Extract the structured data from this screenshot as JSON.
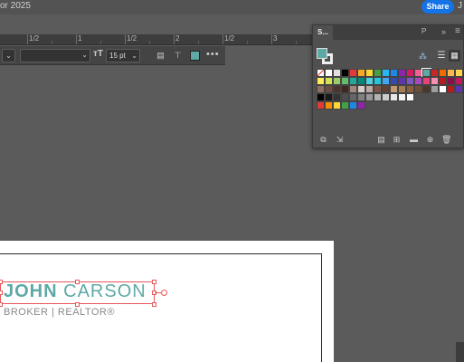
{
  "window": {
    "title_fragment": "or 2025",
    "share_label": "Share",
    "after_share": "J"
  },
  "ruler": {
    "labels": [
      "1/2",
      "1",
      "1/2",
      "2",
      "1/2",
      "3"
    ]
  },
  "control_bar": {
    "font_style_value": "",
    "font_size_value": "15 pt",
    "size_icon": "text-size-icon",
    "more_label": "•••"
  },
  "swatches_panel": {
    "tab_label": "S...",
    "other_tab_label": "P",
    "collapse_label": "»",
    "menu_label": "≡",
    "fill_color": "#5ea9a5",
    "view_list_icon": "list-view-icon",
    "view_grid_icon": "grid-view-icon",
    "swatch_rows": [
      [
        "none",
        "#ffffff",
        "#e0e0e0",
        "#000000",
        "#e53935",
        "#f9a825",
        "#fdd835",
        "#43a047",
        "#29b6f6",
        "#1e88e5",
        "#8e24aa",
        "#d81b60",
        "#f06292",
        "#5ea9a5",
        "#c62828",
        "#ef6c00",
        "#ffb74d",
        "#ffd54f"
      ],
      [
        "#ffee58",
        "#d4e157",
        "#9ccc65",
        "#66bb6a",
        "#26a69a",
        "#00897b",
        "#4dd0e1",
        "#26c6da",
        "#42a5f5",
        "#3949ab",
        "#5e35b1",
        "#7e57c2",
        "#ab47bc",
        "#ec407a",
        "#f48fb1",
        "#b71c1c",
        "#880e4f",
        "#c2185b"
      ],
      [
        "#8d6e63",
        "#6d4c41",
        "#4e342e",
        "#3e2723",
        "#a1887f",
        "#d7ccc8",
        "#bcaaa4",
        "#795548",
        "#5d4037",
        "#bf9a72",
        "#a67c52",
        "#8b5e3c",
        "#6f4e37",
        "#4a3728",
        "#9e9e9e",
        "#ffffff",
        "#b71c1c",
        "#5e35b1"
      ],
      [
        "#000000",
        "#1a1a1a",
        "#333333",
        "#4d4d4d",
        "#666666",
        "#808080",
        "#999999",
        "#b3b3b3",
        "#cccccc",
        "#e6e6e6",
        "#f2f2f2",
        "#ffffff"
      ],
      [
        "#e53935",
        "#fb8c00",
        "#fdd835",
        "#43a047",
        "#1e88e5",
        "#8e24aa"
      ]
    ]
  },
  "artboard": {
    "name_first": "JOHN",
    "name_last": "CARSON",
    "role_line": "BROKER | REALTOR®"
  }
}
